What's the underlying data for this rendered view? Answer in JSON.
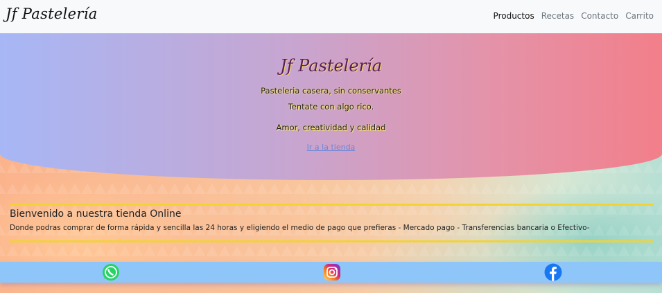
{
  "brand": "Jf Pastelería",
  "nav": {
    "items": [
      "Productos",
      "Recetas",
      "Contacto",
      "Carrito"
    ]
  },
  "hero": {
    "title": "Jf Pastelería",
    "line1": "Pasteleria casera, sin conservantes",
    "line2": "Tentate con algo rico.",
    "line3": "Amor, creatividad y calidad",
    "link": "Ir a la tienda"
  },
  "welcome": {
    "heading": "Bienvenido a nuestra tienda Online",
    "text": "Donde podras comprar de forma rápida y sencilla las 24 horas y eligiendo el medio de pago que prefieras - Mercado pago - Transferencias bancaria o Efectivo-"
  },
  "footer": {
    "icons": [
      "whatsapp-icon",
      "instagram-icon",
      "facebook-icon"
    ]
  },
  "colors": {
    "navbar": "#f8f9fa",
    "hero_start": "#a7b7f6",
    "hero_end": "#f27f8a",
    "accent_rule": "#f2d336",
    "footer": "#8ec6f9"
  }
}
